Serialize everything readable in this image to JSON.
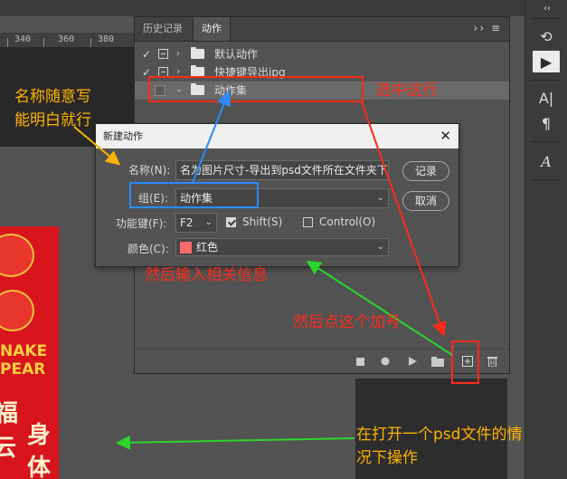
{
  "ruler": {
    "ticks": [
      "340",
      "360",
      "380"
    ]
  },
  "panel": {
    "tabs": [
      {
        "label": "历史记录",
        "active": false
      },
      {
        "label": "动作",
        "active": true
      }
    ],
    "menu_icon": "panel-menu-icon",
    "rows": [
      {
        "label": "默认动作",
        "checked": true,
        "selected": false
      },
      {
        "label": "快捷键导出jpg",
        "checked": true,
        "selected": false
      },
      {
        "label": "动作集",
        "checked": false,
        "selected": true
      }
    ],
    "footer_icons": [
      "stop-icon",
      "record-icon",
      "play-icon",
      "folder-icon",
      "new-action-icon",
      "trash-icon"
    ]
  },
  "dialog": {
    "title": "新建动作",
    "close_glyph": "✕",
    "name_label": "名称(N):",
    "name_value": "名为图片尺寸-导出到psd文件所在文件夹下",
    "group_label": "组(E):",
    "group_value": "动作集",
    "fkey_label": "功能键(F):",
    "fkey_value": "F2",
    "shift_label": "Shift(S)",
    "shift_checked": true,
    "control_label": "Control(O)",
    "control_checked": false,
    "color_label": "颜色(C):",
    "color_value": "红色",
    "color_swatch": "#ff6a6a",
    "record_button": "记录",
    "cancel_button": "取消"
  },
  "annotations": {
    "select_row": "选中这行",
    "name_hint_line1": "名称随意写",
    "name_hint_line2": "能明白就行",
    "enter_info": "然后输入相关信息",
    "click_plus": "然后点这个加号",
    "psd_open_line1": "在打开一个psd文件的情",
    "psd_open_line2": "况下操作",
    "colors": {
      "red": "#ff2a1a",
      "blue": "#2a8cff",
      "orange": "#ffb200",
      "green": "#2bd62b"
    }
  },
  "poster": {
    "text_line1": "NAKE",
    "text_line2": "PEAR",
    "glyphs": [
      "福",
      "身",
      "云",
      "体"
    ]
  },
  "toolbar": {
    "collapse_glyph": "‹‹",
    "icons": [
      "history-brush-icon",
      "actions-play-icon",
      "character-icon",
      "paragraph-icon",
      "glyphs-icon"
    ],
    "glyphs": [
      "⟲",
      "▶",
      "A|",
      "¶",
      "A"
    ]
  }
}
